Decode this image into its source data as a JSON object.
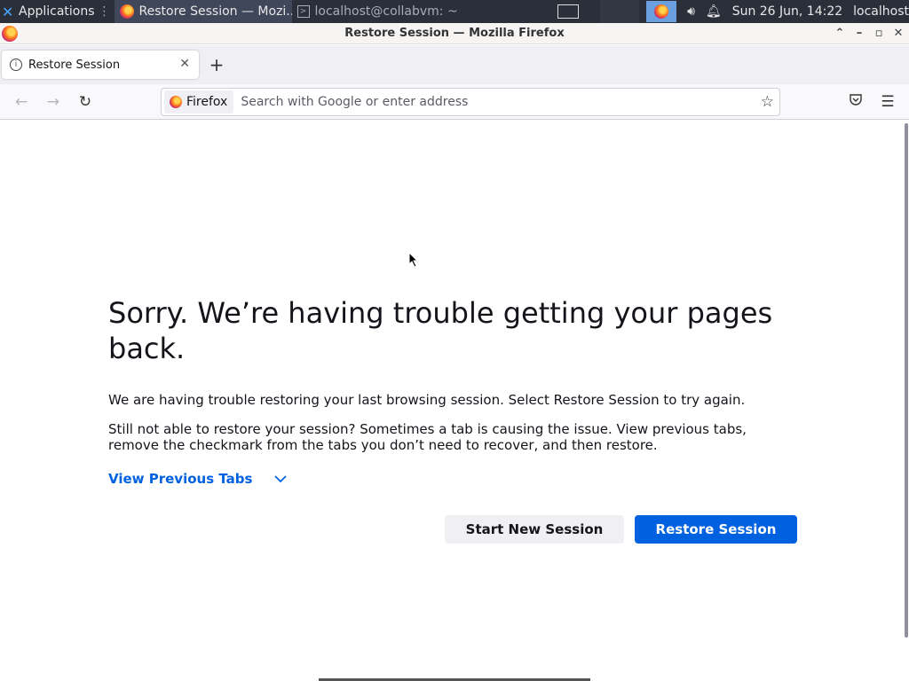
{
  "taskbar": {
    "applications_label": "Applications",
    "tasks": [
      {
        "label": "Restore Session — Mozi...",
        "icon": "firefox-icon",
        "active": true
      },
      {
        "label": "localhost@collabvm: ~",
        "icon": "terminal-icon",
        "active": false
      }
    ],
    "clock": "Sun 26 Jun, 14:22",
    "hostname": "localhost"
  },
  "window": {
    "title": "Restore Session — Mozilla Firefox"
  },
  "tabs": [
    {
      "label": "Restore Session",
      "icon": "info-icon"
    }
  ],
  "navbar": {
    "identity_label": "Firefox",
    "url_placeholder": "Search with Google or enter address"
  },
  "page": {
    "heading": "Sorry. We’re having trouble getting your pages back.",
    "para1": "We are having trouble restoring your last browsing session. Select Restore Session to try again.",
    "para2": "Still not able to restore your session? Sometimes a tab is causing the issue. View previous tabs, remove the checkmark from the tabs you don’t need to recover, and then restore.",
    "view_tabs_label": "View Previous Tabs",
    "start_new_label": "Start New Session",
    "restore_label": "Restore Session"
  },
  "colors": {
    "accent": "#0061e0",
    "taskbar_bg": "#2b2f3a"
  }
}
